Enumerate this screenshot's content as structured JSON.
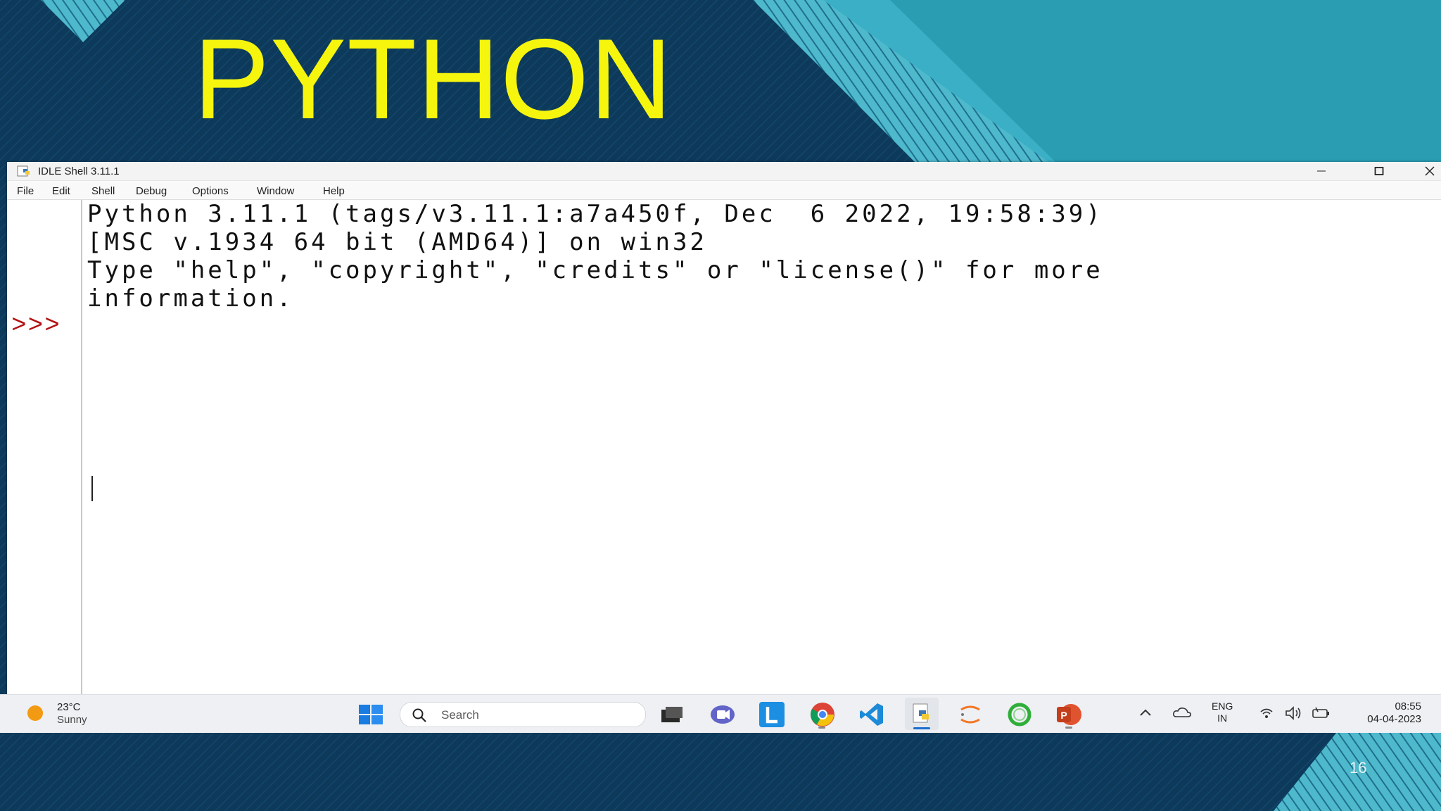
{
  "slide": {
    "title": "PYTHON",
    "page_number": "16"
  },
  "window": {
    "title": "IDLE Shell 3.11.1",
    "controls": {
      "minimize": "—",
      "maximize": "☐",
      "close": "✕"
    }
  },
  "menu": [
    "File",
    "Edit",
    "Shell",
    "Debug",
    "Options",
    "Window",
    "Help"
  ],
  "shell": {
    "lines": [
      "Python 3.11.1 (tags/v3.11.1:a7a450f, Dec  6 2022, 19:58:39)",
      "[MSC v.1934 64 bit (AMD64)] on win32",
      "Type \"help\", \"copyright\", \"credits\" or \"license()\" for more",
      "information."
    ],
    "prompt": ">>>"
  },
  "taskbar": {
    "weather": {
      "temperature": "23°C",
      "condition": "Sunny",
      "icon": "sun-icon"
    },
    "search_label": "Search",
    "apps": [
      {
        "name": "task-view",
        "icon": "task-view-icon"
      },
      {
        "name": "chat",
        "icon": "chat-icon"
      },
      {
        "name": "l-app",
        "icon": "l-app-icon"
      },
      {
        "name": "chrome",
        "icon": "chrome-icon"
      },
      {
        "name": "vscode",
        "icon": "vscode-icon"
      },
      {
        "name": "idle",
        "icon": "python-idle-icon",
        "active": true
      },
      {
        "name": "jupyter",
        "icon": "jupyter-icon"
      },
      {
        "name": "green-ring",
        "icon": "green-ring-icon"
      },
      {
        "name": "powerpoint",
        "icon": "powerpoint-icon"
      }
    ],
    "tray": {
      "language_line1": "ENG",
      "language_line2": "IN",
      "time": "08:55",
      "date": "04-04-2023"
    }
  },
  "colors": {
    "title_yellow": "#f5f50e",
    "slide_navy": "#0b3352",
    "slide_teal": "#2a9db3",
    "prompt_red": "#b31212"
  }
}
